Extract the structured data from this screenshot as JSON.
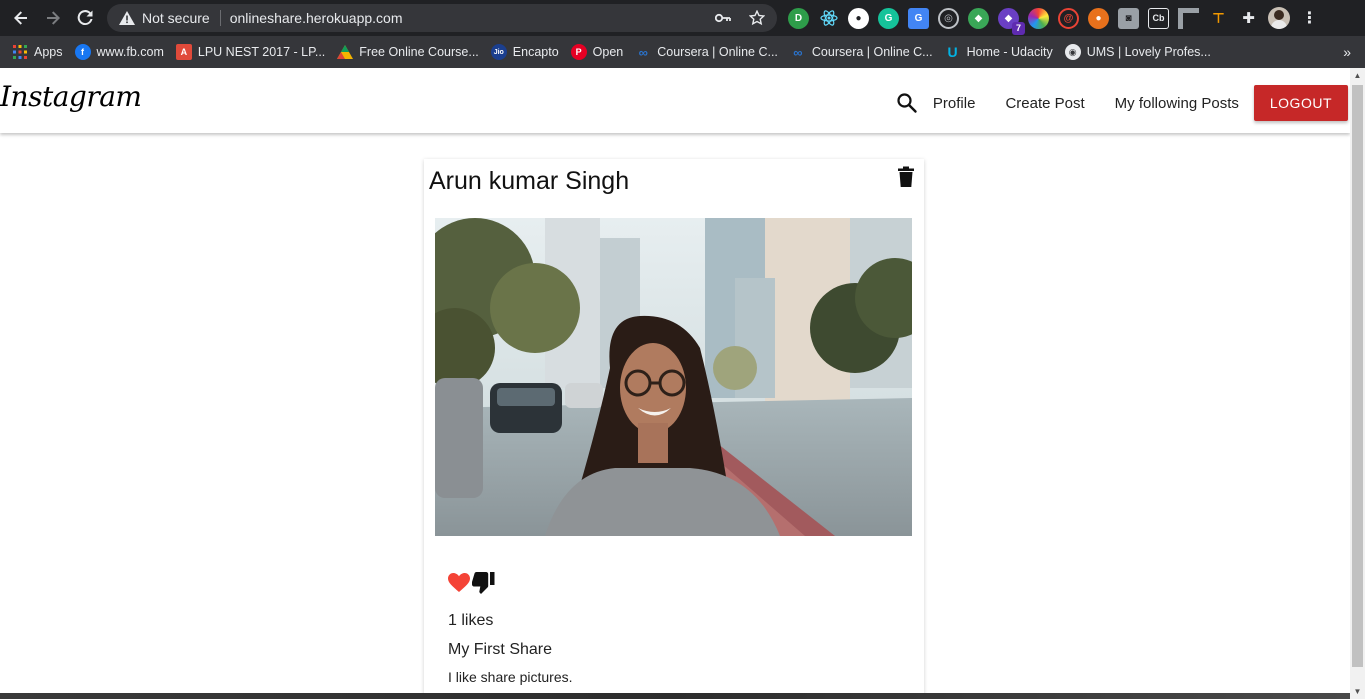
{
  "browser": {
    "security_label": "Not secure",
    "url": "onlineshare.herokuapp.com",
    "extension_badge": "7",
    "extension_text_cb": "Cb"
  },
  "bookmarks": [
    {
      "label": "Apps",
      "icon": "apps-grid-icon",
      "color": "#4285f4"
    },
    {
      "label": "www.fb.com",
      "icon": "facebook-icon",
      "color": "#1877f2"
    },
    {
      "label": "LPU NEST 2017 - LP...",
      "icon": "lpu-icon",
      "color": "#e04a3a"
    },
    {
      "label": "Free Online Course...",
      "icon": "course-icon",
      "color": "#f4b400"
    },
    {
      "label": "Encapto",
      "icon": "jio-icon",
      "color": "#1b3f8f"
    },
    {
      "label": "Open",
      "icon": "pinterest-icon",
      "color": "#e60023"
    },
    {
      "label": "Coursera | Online C...",
      "icon": "coursera-icon",
      "color": "#2a73cc"
    },
    {
      "label": "Coursera | Online C...",
      "icon": "coursera-icon",
      "color": "#2a73cc"
    },
    {
      "label": "Home - Udacity",
      "icon": "udacity-icon",
      "color": "#02b3e4"
    },
    {
      "label": "UMS | Lovely Profes...",
      "icon": "globe-icon",
      "color": "#9aa0a6"
    }
  ],
  "app": {
    "brand": "Instagram",
    "nav": {
      "profile": "Profile",
      "create_post": "Create Post",
      "following": "My following Posts",
      "logout": "LOGOUT"
    }
  },
  "post": {
    "author": "Arun kumar Singh",
    "likes": "1 likes",
    "title": "My First Share",
    "body": "I like share pictures."
  },
  "colors": {
    "logout_bg": "#c62828",
    "heart": "#f44336",
    "chrome_bg": "#202124",
    "bookmarks_bg": "#35363a"
  }
}
